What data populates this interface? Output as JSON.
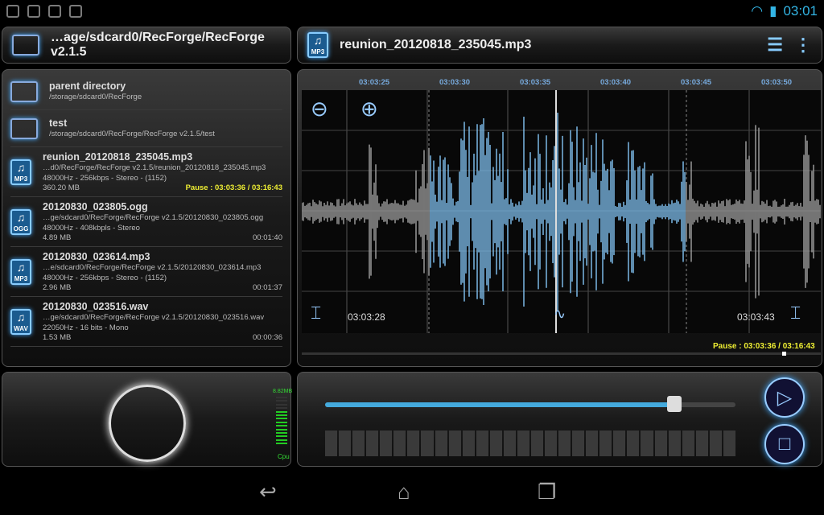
{
  "status_bar": {
    "time": "03:01",
    "icons": [
      "notification-icon",
      "facebook-icon",
      "download-icon",
      "android-icon"
    ]
  },
  "folder_header": {
    "path": "…age/sdcard0/RecForge/RecForge v2.1.5"
  },
  "player_header": {
    "title": "reunion_20120818_235045.mp3",
    "file_type": "MP3"
  },
  "files": [
    {
      "name": "parent directory",
      "path": "/storage/sdcard0/RecForge",
      "icon": "parent-folder-icon"
    },
    {
      "name": "test",
      "path": "/storage/sdcard0/RecForge/RecForge v2.1.5/test",
      "icon": "folder-icon"
    },
    {
      "name": "reunion_20120818_235045.mp3",
      "path": "…d0/RecForge/RecForge v2.1.5/reunion_20120818_235045.mp3",
      "info": "48000Hz - 256kbps - Stereo - (1152)",
      "size": "360.20 MB",
      "status": "Pause : 03:03:36 / 03:16:43",
      "type": "MP3"
    },
    {
      "name": "20120830_023805.ogg",
      "path": "…ge/sdcard0/RecForge/RecForge v2.1.5/20120830_023805.ogg",
      "info": "48000Hz - 408kbpls - Stereo",
      "size": "4.89 MB",
      "status": "00:01:40",
      "type": "OGG"
    },
    {
      "name": "20120830_023614.mp3",
      "path": "…e/sdcard0/RecForge/RecForge v2.1.5/20120830_023614.mp3",
      "info": "48000Hz - 256kbps - Stereo - (1152)",
      "size": "2.96 MB",
      "status": "00:01:37",
      "type": "MP3"
    },
    {
      "name": "20120830_023516.wav",
      "path": "…ge/sdcard0/RecForge/RecForge v2.1.5/20120830_023516.wav",
      "info": "22050Hz - 16 bits - Mono",
      "size": "1.53 MB",
      "status": "00:00:36",
      "type": "WAV"
    }
  ],
  "waveform": {
    "ticks": [
      "03:03:25",
      "03:03:30",
      "03:03:35",
      "03:03:40",
      "03:03:45",
      "03:03:50"
    ],
    "left_marker": "03:03:28",
    "right_marker": "03:03:43",
    "status": "Pause : 03:03:36 / 03:16:43",
    "accent": "#7ab8e6"
  },
  "meter": {
    "label": "8.82MB",
    "cpu_label": "Cpu",
    "level": 0.7
  },
  "seek": {
    "progress": 0.85
  }
}
